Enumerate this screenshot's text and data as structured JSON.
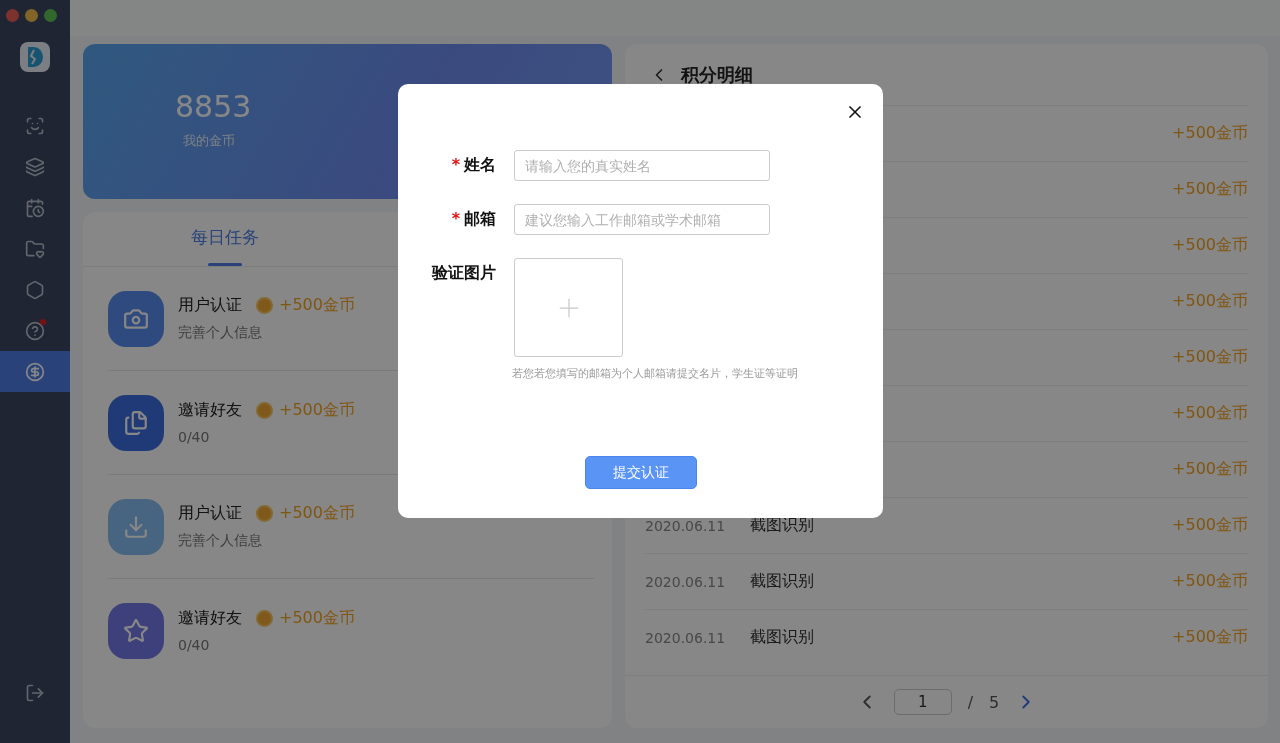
{
  "sidebar": {
    "items": [
      {
        "selected": false
      },
      {
        "selected": false
      },
      {
        "selected": false
      },
      {
        "selected": false
      },
      {
        "selected": false
      },
      {
        "selected": false,
        "badge": true
      },
      {
        "selected": true
      }
    ]
  },
  "coins": {
    "value": "8853",
    "label": "我的金币"
  },
  "tasks": {
    "tabs": [
      {
        "label": "每日任务",
        "selected": true
      }
    ],
    "items": [
      {
        "title": "用户认证",
        "reward": "+500金币",
        "subtitle": "完善个人信息"
      },
      {
        "title": "邀请好友",
        "reward": "+500金币",
        "subtitle": "0/40"
      },
      {
        "title": "用户认证",
        "reward": "+500金币",
        "subtitle": "完善个人信息"
      },
      {
        "title": "邀请好友",
        "reward": "+500金币",
        "subtitle": "0/40"
      }
    ]
  },
  "details": {
    "title": "积分明细",
    "rows": [
      {
        "amount": "+500金币"
      },
      {
        "amount": "+500金币"
      },
      {
        "amount": "+500金币"
      },
      {
        "amount": "+500金币"
      },
      {
        "amount": "+500金币"
      },
      {
        "amount": "+500金币"
      },
      {
        "amount": "+500金币"
      },
      {
        "date": "2020.06.11",
        "label": "截图识别",
        "amount": "+500金币"
      },
      {
        "date": "2020.06.11",
        "label": "截图识别",
        "amount": "+500金币"
      },
      {
        "date": "2020.06.11",
        "label": "截图识别",
        "amount": "+500金币"
      }
    ],
    "pager": {
      "page": "1",
      "separator": "/",
      "total": "5"
    }
  },
  "dialog": {
    "fields": [
      {
        "marker": "*",
        "label": "姓名",
        "placeholder": "请输入您的真实姓名"
      },
      {
        "marker": "*",
        "label": "邮箱",
        "placeholder": "建议您输入工作邮箱或学术邮箱"
      }
    ],
    "upload": {
      "label": "验证图片",
      "hint": "若您若您填写的邮箱为个人邮箱请提交名片，学生证等证明"
    },
    "submit": "提交认证"
  }
}
